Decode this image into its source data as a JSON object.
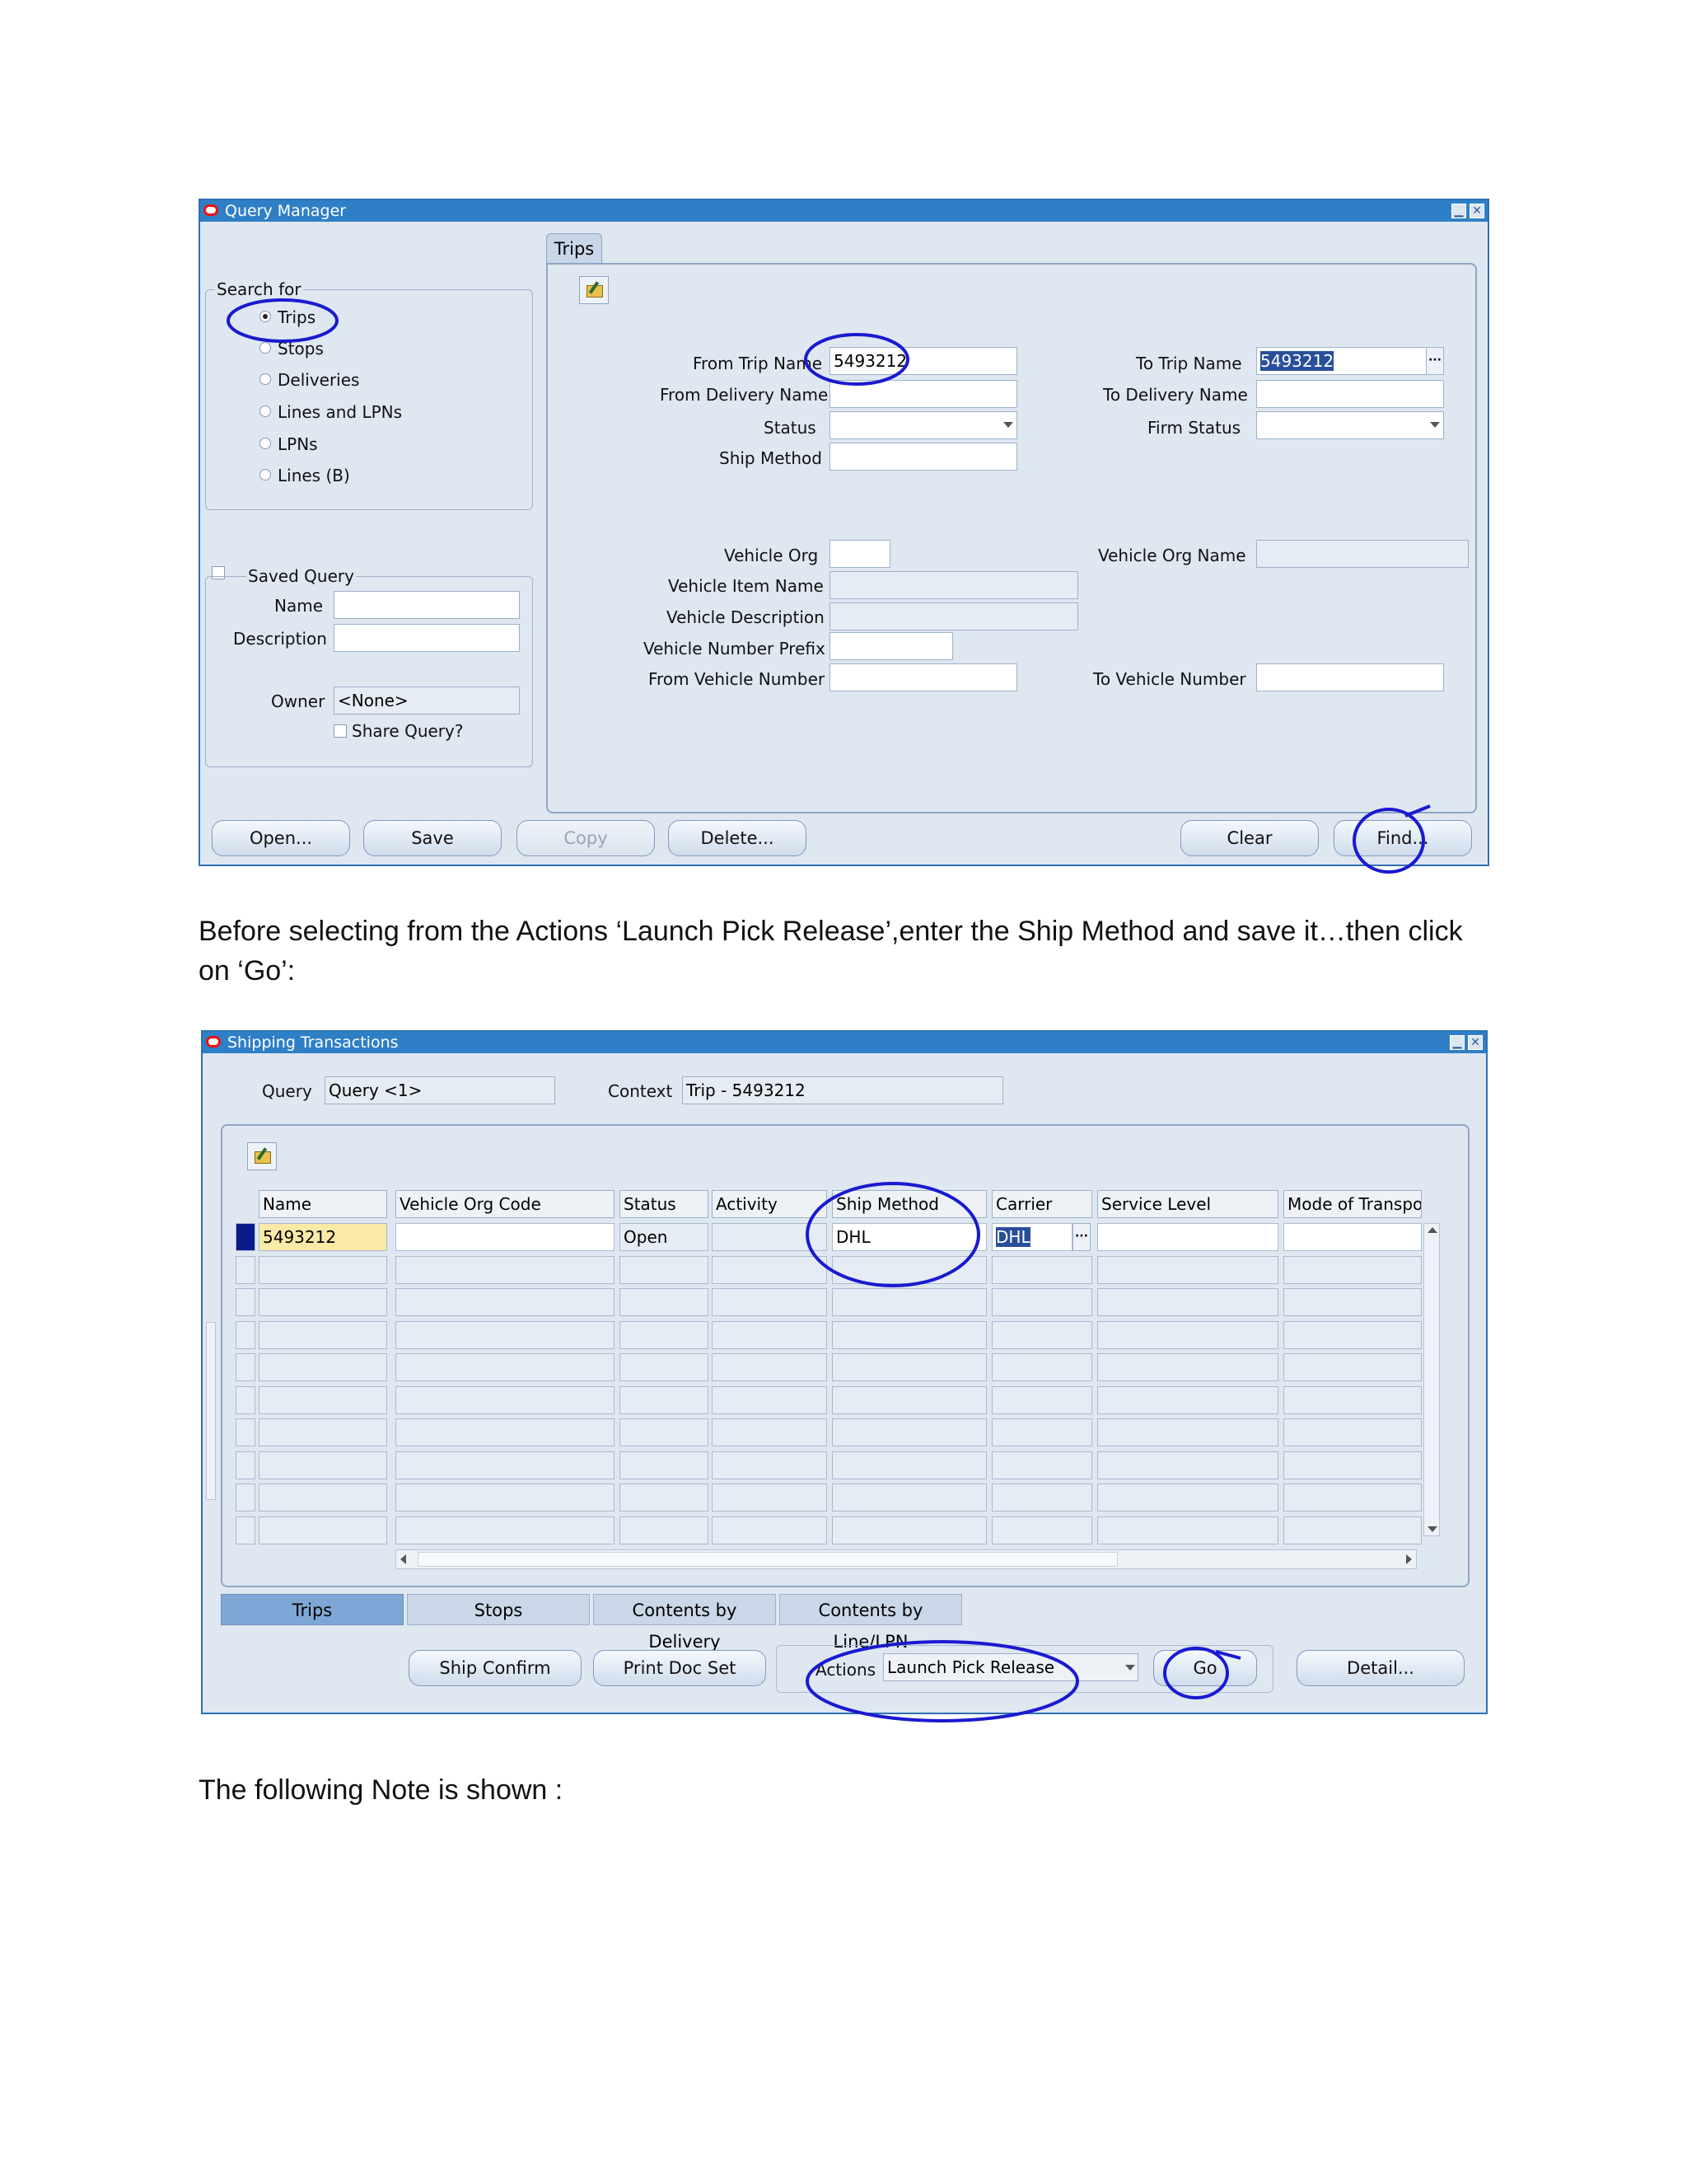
{
  "query_manager": {
    "title": "Query Manager",
    "tab_trips": "Trips",
    "search_for_label": "Search for",
    "search_options": [
      "Trips",
      "Stops",
      "Deliveries",
      "Lines and LPNs",
      "LPNs",
      "Lines (B)"
    ],
    "selected_option": "Trips",
    "from_trip_name_label": "From Trip Name",
    "from_trip_name_value": "5493212",
    "to_trip_name_label": "To Trip Name",
    "to_trip_name_value": "5493212",
    "from_delivery_name_label": "From Delivery Name",
    "to_delivery_name_label": "To Delivery Name",
    "status_label": "Status",
    "firm_status_label": "Firm Status",
    "ship_method_label": "Ship Method",
    "vehicle_org_label": "Vehicle Org",
    "vehicle_org_name_label": "Vehicle Org Name",
    "vehicle_item_name_label": "Vehicle Item Name",
    "vehicle_description_label": "Vehicle Description",
    "vehicle_number_prefix_label": "Vehicle Number Prefix",
    "from_vehicle_number_label": "From Vehicle Number",
    "to_vehicle_number_label": "To Vehicle Number",
    "saved_query_label": "Saved Query",
    "name_label": "Name",
    "description_label": "Description",
    "owner_label": "Owner",
    "owner_value": "<None>",
    "share_query_label": "Share Query?",
    "buttons": {
      "open": "Open...",
      "save": "Save",
      "copy": "Copy",
      "delete": "Delete...",
      "clear": "Clear",
      "find": "Find..."
    }
  },
  "paragraph_1": "Before selecting from the Actions ‘Launch Pick Release’,enter the Ship Method and save it…then click on ‘Go’:",
  "shipping_transactions": {
    "title": "Shipping Transactions",
    "query_label": "Query",
    "query_value": "Query <1>",
    "context_label": "Context",
    "context_value": "Trip - 5493212",
    "columns": [
      "Name",
      "Vehicle Org Code",
      "Status",
      "Activity",
      "Ship Method",
      "Carrier",
      "Service Level",
      "Mode of Transpor"
    ],
    "rows": [
      {
        "name": "5493212",
        "vehicle_org_code": "",
        "status": "Open",
        "activity": "",
        "ship_method": "DHL",
        "carrier": "DHL",
        "service_level": "",
        "mode_of_transport": ""
      }
    ],
    "bottom_tabs": [
      "Trips",
      "Stops",
      "Contents by Delivery",
      "Contents by Line/LPN"
    ],
    "active_tab": "Trips",
    "buttons": {
      "ship_confirm": "Ship Confirm",
      "print_doc_set": "Print Doc Set",
      "go": "Go",
      "detail": "Detail..."
    },
    "actions_label": "Actions",
    "actions_value": "Launch Pick Release"
  },
  "paragraph_2": "The following Note is shown :",
  "colors": {
    "title_bar": "#2f7fc6",
    "window_bg": "#dfe7f1",
    "annotation_ink": "#1a1ad0",
    "current_record": "#0a1a8a",
    "highlight_cell": "#fbe9a8"
  }
}
